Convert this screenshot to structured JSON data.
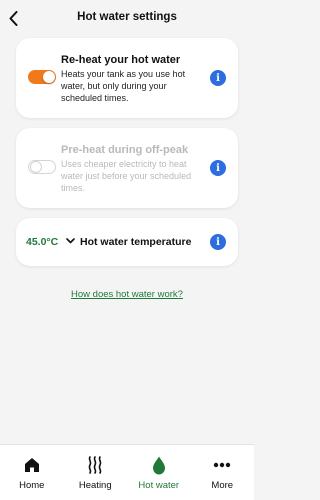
{
  "header": {
    "title": "Hot water settings",
    "back_icon": "chevron-left-icon"
  },
  "settings": [
    {
      "title": "Re-heat your hot water",
      "description": "Heats your tank as you use hot water, but only during your scheduled times.",
      "enabled": true,
      "disabled_appearance": false
    },
    {
      "title": "Pre-heat during off-peak",
      "description": "Uses cheaper electricity to heat water just before your scheduled times.",
      "enabled": false,
      "disabled_appearance": true
    }
  ],
  "temperature": {
    "value": "45.0°C",
    "label": "Hot water temperature"
  },
  "info_glyph": "i",
  "help_link": "How does hot water work?",
  "tabs": [
    {
      "label": "Home",
      "icon": "home-icon",
      "active": false
    },
    {
      "label": "Heating",
      "icon": "heat-waves-icon",
      "active": false
    },
    {
      "label": "Hot water",
      "icon": "water-drop-icon",
      "active": true
    },
    {
      "label": "More",
      "icon": "more-dots-icon",
      "active": false
    }
  ],
  "colors": {
    "toggle_on": "#f07a1a",
    "accent_green": "#1f7a3a",
    "info_blue": "#2d6de0"
  }
}
